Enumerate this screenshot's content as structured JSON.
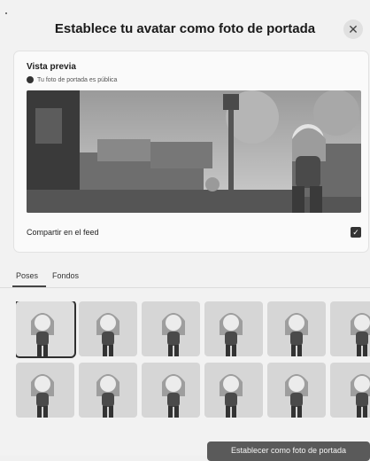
{
  "dialog": {
    "title": "Establece tu avatar como foto de portada",
    "close_icon": "close-icon"
  },
  "preview": {
    "heading": "Vista previa",
    "visibility_icon": "globe-icon",
    "visibility_text": "Tu foto de portada es pública"
  },
  "share": {
    "label": "Compartir en el feed",
    "checked": true,
    "check_glyph": "✓"
  },
  "tabs": {
    "items": [
      "Poses",
      "Fondos"
    ],
    "active": "Poses"
  },
  "poses": {
    "count_visible": 12,
    "selected_index": 0
  },
  "footer": {
    "button_label": "Establecer como foto de portada"
  }
}
